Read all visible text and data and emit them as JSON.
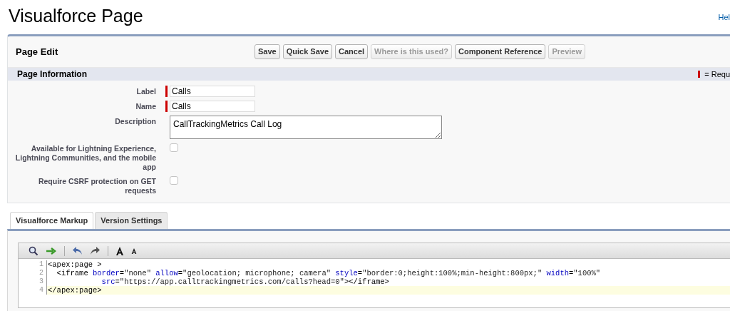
{
  "page_title": "Visualforce Page",
  "help_link": "Hel",
  "edit_panel": {
    "title": "Page Edit",
    "buttons": [
      {
        "label": "Save",
        "disabled": false
      },
      {
        "label": "Quick Save",
        "disabled": false
      },
      {
        "label": "Cancel",
        "disabled": false
      },
      {
        "label": "Where is this used?",
        "disabled": true
      },
      {
        "label": "Component Reference",
        "disabled": false
      },
      {
        "label": "Preview",
        "disabled": true
      }
    ],
    "section": {
      "title": "Page Information",
      "required_legend": "= Requ"
    },
    "fields": [
      {
        "kind": "text",
        "label": "Label",
        "value": "Calls",
        "required": true
      },
      {
        "kind": "text",
        "label": "Name",
        "value": "Calls",
        "required": true
      },
      {
        "kind": "textarea",
        "label": "Description",
        "value": "CallTrackingMetrics Call Log"
      },
      {
        "kind": "checkbox",
        "label": "Available for Lightning Experience, Lightning Communities, and the mobile app",
        "checked": false
      },
      {
        "kind": "checkbox",
        "label": "Require CSRF protection on GET requests",
        "checked": false
      }
    ]
  },
  "tabs": [
    {
      "label": "Visualforce Markup",
      "selected": true
    },
    {
      "label": "Version Settings",
      "selected": false
    }
  ],
  "editor": {
    "lines": [
      {
        "number": "1",
        "current": false,
        "tokens": [
          {
            "kind": "tag",
            "text": "<apex:page >"
          }
        ]
      },
      {
        "number": "2",
        "current": false,
        "tokens": [
          {
            "kind": "tag",
            "text": "  <iframe"
          },
          {
            "kind": "attr",
            "text": " border"
          },
          {
            "kind": "plain",
            "text": "="
          },
          {
            "kind": "value",
            "text": "\"none\""
          },
          {
            "kind": "attr",
            "text": " allow"
          },
          {
            "kind": "plain",
            "text": "="
          },
          {
            "kind": "value",
            "text": "\"geolocation; microphone; camera\""
          },
          {
            "kind": "attr",
            "text": " style"
          },
          {
            "kind": "plain",
            "text": "="
          },
          {
            "kind": "value",
            "text": "\"border:0;height:100%;min-height:800px;\""
          },
          {
            "kind": "attr",
            "text": " width"
          },
          {
            "kind": "plain",
            "text": "="
          },
          {
            "kind": "value",
            "text": "\"100%\""
          }
        ]
      },
      {
        "number": "3",
        "current": false,
        "tokens": [
          {
            "kind": "attr",
            "text": "            src"
          },
          {
            "kind": "plain",
            "text": "="
          },
          {
            "kind": "value",
            "text": "\"https://app.calltrackingmetrics.com/calls?head=0\""
          },
          {
            "kind": "tag",
            "text": "></iframe>"
          }
        ]
      },
      {
        "number": "4",
        "current": true,
        "tokens": [
          {
            "kind": "tag",
            "text": "</apex:page>"
          }
        ]
      }
    ]
  }
}
